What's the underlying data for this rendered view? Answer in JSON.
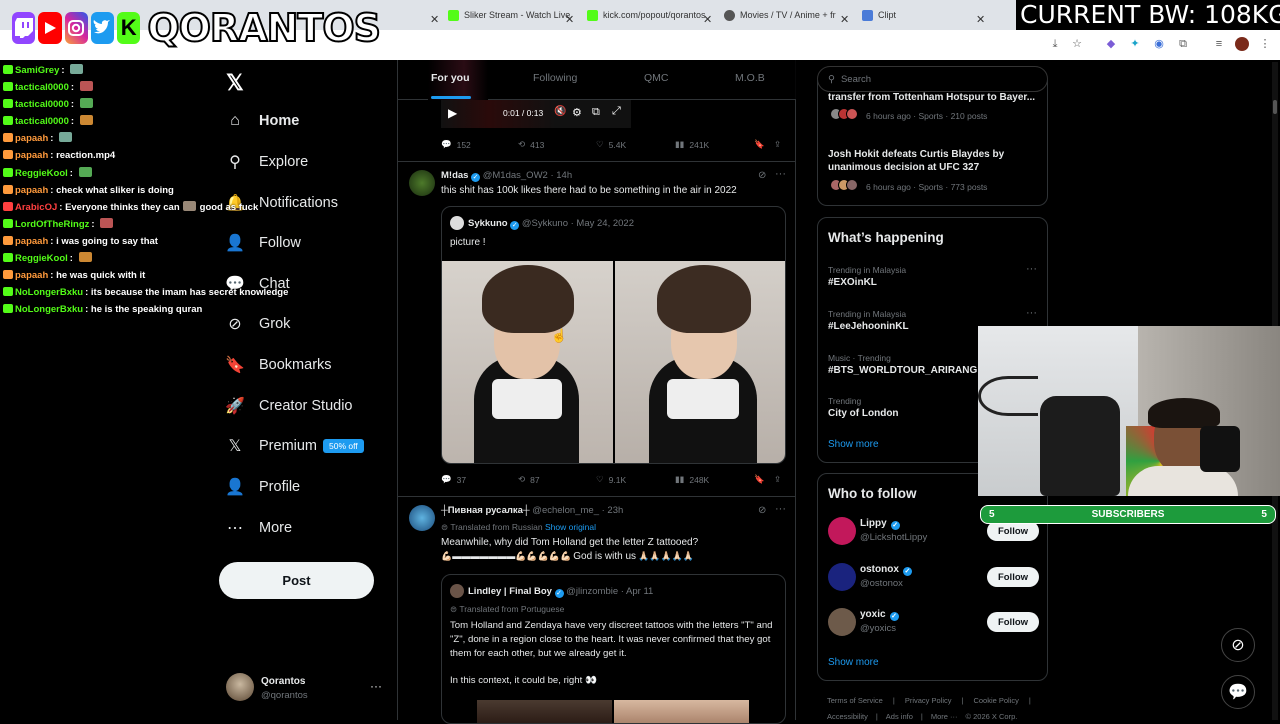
{
  "browser": {
    "tabs": [
      {
        "title": "Sliker Stream - Watch Live",
        "color": "#53fc18"
      },
      {
        "title": "kick.com/popout/qorantos",
        "color": "#53fc18"
      },
      {
        "title": "Movies / TV / Anime + free",
        "color": "#555555"
      },
      {
        "title": "Clipt",
        "color": "#4a7bd8"
      }
    ]
  },
  "overlay": {
    "brand": "QORANTOS",
    "bandwidth": "CURRENT BW: 108KG",
    "subscribers_label": "SUBSCRIBERS",
    "subscribers_left": "5",
    "subscribers_right": "5"
  },
  "chat": [
    {
      "user": "SamiGrey",
      "msg": "",
      "color": "#53fc18"
    },
    {
      "user": "tactical0000",
      "msg": "",
      "color": "#53fc18"
    },
    {
      "user": "tactical0000",
      "msg": "",
      "color": "#53fc18"
    },
    {
      "user": "tactical0000",
      "msg": "",
      "color": "#53fc18"
    },
    {
      "user": "papaah",
      "msg": "",
      "color": "#ff9a3c"
    },
    {
      "user": "papaah",
      "msg": "reaction.mp4",
      "color": "#ff9a3c"
    },
    {
      "user": "ReggieKool",
      "msg": "",
      "color": "#53fc18"
    },
    {
      "user": "papaah",
      "msg": "check what sliker is doing",
      "color": "#ff9a3c"
    },
    {
      "user": "ArabicOJ",
      "msg": "Everyone thinks they can",
      "color": "#ff4040"
    },
    {
      "user": "LordOfTheRingz",
      "msg": "",
      "color": "#53fc18"
    },
    {
      "user": "papaah",
      "msg": "i was going to say that",
      "color": "#ff9a3c"
    },
    {
      "user": "ReggieKool",
      "msg": "",
      "color": "#53fc18"
    },
    {
      "user": "papaah",
      "msg": "he was quick with it",
      "color": "#ff9a3c"
    },
    {
      "user": "NoLongerBxku",
      "msg": "its because the imam has secret knowledge",
      "color": "#53fc18"
    },
    {
      "user": "NoLongerBxku",
      "msg": "he is the speaking quran",
      "color": "#53fc18"
    }
  ],
  "chat_extra": "good as fuck",
  "nav": {
    "items": [
      {
        "label": "Home",
        "icon": "home-icon",
        "glyph": "⌂"
      },
      {
        "label": "Explore",
        "icon": "search-icon",
        "glyph": "⚲"
      },
      {
        "label": "Notifications",
        "icon": "bell-icon",
        "glyph": "🔔"
      },
      {
        "label": "Follow",
        "icon": "person-plus-icon",
        "glyph": "👤"
      },
      {
        "label": "Chat",
        "icon": "chat-icon",
        "glyph": "💬"
      },
      {
        "label": "Grok",
        "icon": "grok-icon",
        "glyph": "⊘"
      },
      {
        "label": "Bookmarks",
        "icon": "bookmark-icon",
        "glyph": "🔖"
      },
      {
        "label": "Creator Studio",
        "icon": "rocket-icon",
        "glyph": "🚀"
      },
      {
        "label": "Premium",
        "icon": "x-icon",
        "glyph": "𝕏"
      },
      {
        "label": "Profile",
        "icon": "profile-icon",
        "glyph": "👤"
      },
      {
        "label": "More",
        "icon": "more-icon",
        "glyph": "⋯"
      }
    ],
    "premium_badge": "50% off",
    "post_label": "Post",
    "account_name": "Qorantos",
    "account_handle": "@qorantos"
  },
  "feed": {
    "tabs": [
      "For you",
      "Following",
      "QMC",
      "M.O.B"
    ],
    "video_time": "0:01 / 0:13",
    "post0_stats": {
      "replies": "152",
      "reposts": "413",
      "likes": "5.4K",
      "views": "241K"
    },
    "post1": {
      "name": "M!das",
      "handle": "@M1das_OW2",
      "time": "· 14h",
      "text": "this shit has 100k likes there had to be something in the air in 2022",
      "quote_name": "Sykkuno",
      "quote_handle": "@Sykkuno",
      "quote_date": "· May 24, 2022",
      "quote_text": "picture !",
      "stats": {
        "replies": "37",
        "reposts": "87",
        "likes": "9.1K",
        "views": "248K"
      }
    },
    "post2": {
      "name": "┼Пивная русалка┼",
      "handle": "@echelon_me_",
      "time": "· 23h",
      "translated": "Translated from Russian",
      "show_original": "Show original",
      "text": "Meanwhile, why did Tom Holland get the letter Z tattooed?",
      "text2": "God is with us",
      "quote_name": "Lindley | Final Boy",
      "quote_handle": "@jlinzombie",
      "quote_date": "· Apr 11",
      "quote_translated": "Translated from Portuguese",
      "quote_text": "Tom Holland and Zendaya have very discreet tattoos with the letters \"T\" and \"Z\", done in a region close to the heart. It was never confirmed that they got them for each other, but we already get it.",
      "quote_text2": "In this context, it could be, right"
    }
  },
  "right": {
    "search_placeholder": "Search",
    "news": [
      {
        "title": "transfer from Tottenham Hotspur to Bayer...",
        "meta": "6 hours ago · Sports · 210 posts"
      },
      {
        "title": "Josh Hokit defeats Curtis Blaydes by unanimous decision at UFC 327",
        "meta": "6 hours ago · Sports · 773 posts"
      }
    ],
    "happening_title": "What’s happening",
    "trends": [
      {
        "context": "Trending in Malaysia",
        "name": "#EXOinKL"
      },
      {
        "context": "Trending in Malaysia",
        "name": "#LeeJehooninKL"
      },
      {
        "context": "Music · Trending",
        "name": "#BTS_WORLDTOUR_ARIRANG"
      },
      {
        "context": "Trending",
        "name": "City of London"
      }
    ],
    "show_more": "Show more",
    "wtf_title": "Who to follow",
    "follow": [
      {
        "name": "Lippy",
        "handle": "@LickshotLippy",
        "color": "#c2185b"
      },
      {
        "name": "ostonox",
        "handle": "@ostonox",
        "color": "#1a237e"
      },
      {
        "name": "yoxic",
        "handle": "@yoxics",
        "color": "#6d5a4a"
      }
    ],
    "follow_label": "Follow",
    "footer1": [
      "Terms of Service",
      "Privacy Policy",
      "Cookie Policy"
    ],
    "footer2": [
      "Accessibility",
      "Ads info",
      "More ···",
      "© 2026 X Corp."
    ]
  },
  "colors": {
    "accent": "#1d9bf0",
    "kick_green": "#53fc18"
  }
}
